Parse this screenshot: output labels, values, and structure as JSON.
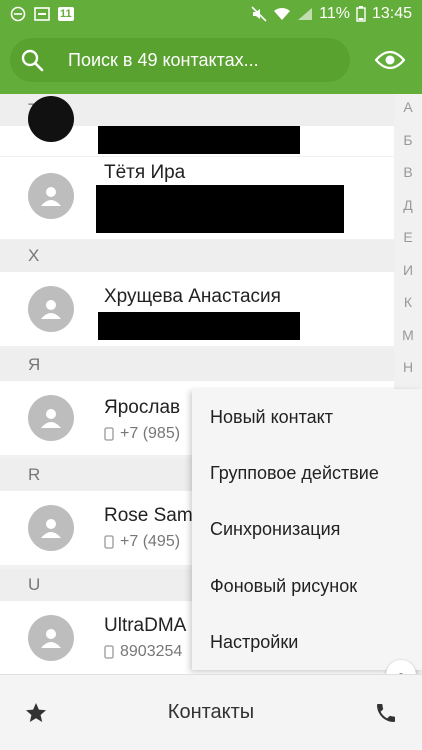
{
  "status_bar": {
    "battery": "11%",
    "time": "13:45",
    "badge": "11"
  },
  "search": {
    "placeholder": "Поиск в 49 контактах..."
  },
  "index_letters": [
    "А",
    "Б",
    "В",
    "Д",
    "Е",
    "И",
    "К",
    "М",
    "Н"
  ],
  "sections": {
    "t": "Т",
    "kh": "Х",
    "ya": "Я",
    "r": "R",
    "u": "U"
  },
  "contacts": [
    {
      "name": "Тётя Ира",
      "phone": ""
    },
    {
      "name": "Хрущева Анастасия",
      "phone": ""
    },
    {
      "name": "Ярослав",
      "phone": "+7 (985)"
    },
    {
      "name": "Rose Sam",
      "phone": "+7 (495)"
    },
    {
      "name": "UltraDMA",
      "phone": "8903254"
    }
  ],
  "menu": {
    "items": [
      "Новый контакт",
      "Групповое действие",
      "Синхронизация",
      "Фоновый рисунок",
      "Настройки"
    ]
  },
  "bottom_bar": {
    "title": "Контакты"
  },
  "colors": {
    "accent": "#63ad3a"
  }
}
